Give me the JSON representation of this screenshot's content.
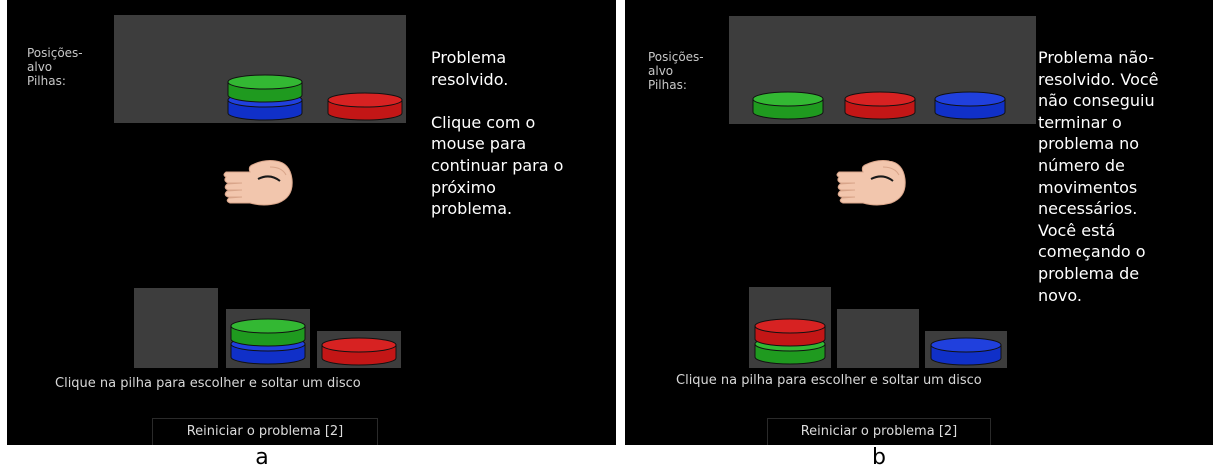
{
  "colors": {
    "green": "#1f9a1f",
    "green_top": "#33b833",
    "blue": "#1030c8",
    "blue_top": "#2040dd",
    "red": "#c31616",
    "red_top": "#d72222",
    "panel_bg": "#000000",
    "box_bg": "#3d3d3d",
    "hand_skin": "#f2c6ad"
  },
  "icons": {
    "hand": "hand-icon"
  },
  "panels": [
    {
      "id": "a",
      "targets_label": "Posições-\nalvo\nPilhas:",
      "target_stacks": [
        [
          "blue",
          "green"
        ],
        [
          "red"
        ]
      ],
      "message": "Problema\nresolvido.\n\nClique com o\nmouse para\ncontinuar para o\npróximo\nproblema.",
      "stacks": [
        [],
        [
          "blue",
          "green"
        ],
        [
          "red"
        ]
      ],
      "hint": "Clique na pilha para escolher e soltar um disco",
      "restart_label": "Reiniciar o problema [2]",
      "caption": "a"
    },
    {
      "id": "b",
      "targets_label": "Posições-\nalvo\nPilhas:",
      "target_stacks": [
        [
          "green"
        ],
        [
          "red"
        ],
        [
          "blue"
        ]
      ],
      "message": "Problema não-\nresolvido.  Você\nnão conseguiu\nterminar o\nproblema no\nnúmero de\nmovimentos\nnecessários.\nVocê está\ncomeçando o\nproblema de\nnovo.",
      "stacks": [
        [
          "green",
          "red"
        ],
        [],
        [
          "blue"
        ]
      ],
      "hint": "Clique na pilha para escolher e soltar um disco",
      "restart_label": "Reiniciar o problema [2]",
      "caption": "b"
    }
  ]
}
